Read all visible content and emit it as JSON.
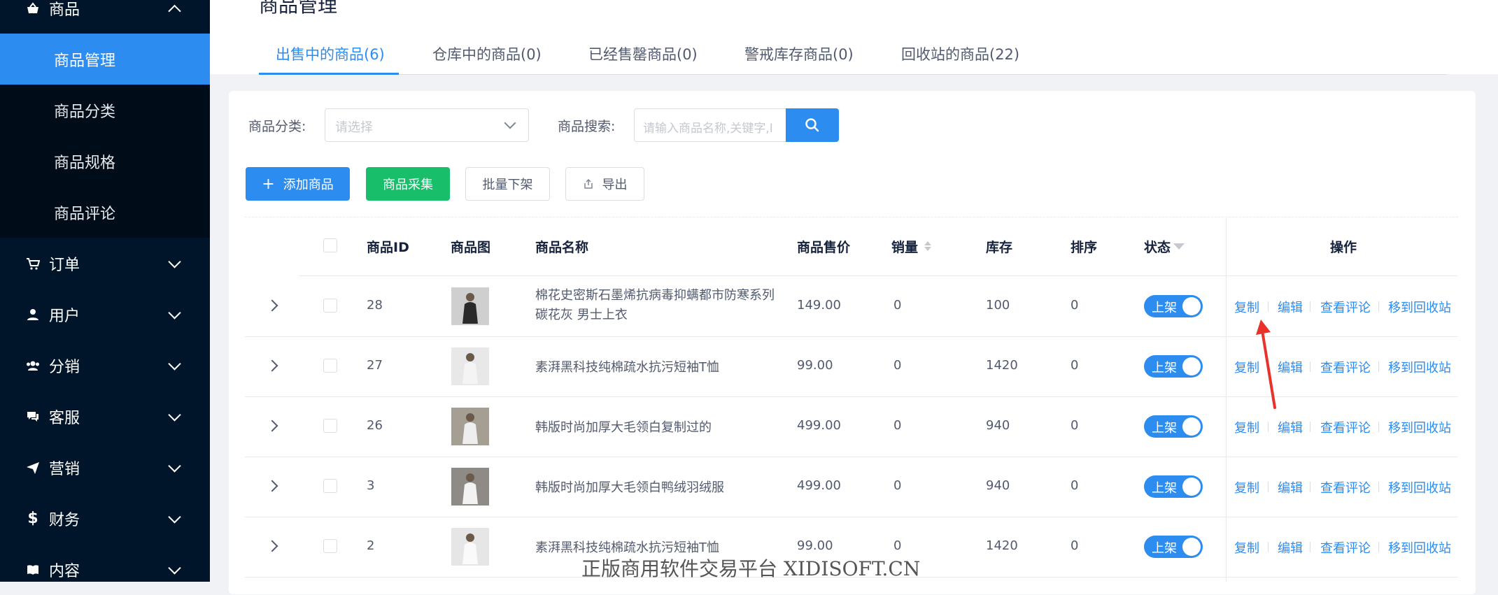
{
  "sidebar": {
    "groups": [
      {
        "label": "商品",
        "icon": "basket-icon"
      },
      {
        "label": "订单",
        "icon": "cart-icon"
      },
      {
        "label": "用户",
        "icon": "user-icon"
      },
      {
        "label": "分销",
        "icon": "group-icon"
      },
      {
        "label": "客服",
        "icon": "chat-icon"
      },
      {
        "label": "营销",
        "icon": "send-icon"
      },
      {
        "label": "财务",
        "icon": "dollar-icon"
      },
      {
        "label": "内容",
        "icon": "book-icon"
      }
    ],
    "sub_items": [
      {
        "label": "商品管理"
      },
      {
        "label": "商品分类"
      },
      {
        "label": "商品规格"
      },
      {
        "label": "商品评论"
      }
    ]
  },
  "header": {
    "title": "商品管理",
    "tabs": [
      {
        "label": "出售中的商品(6)"
      },
      {
        "label": "仓库中的商品(0)"
      },
      {
        "label": "已经售罄商品(0)"
      },
      {
        "label": "警戒库存商品(0)"
      },
      {
        "label": "回收站的商品(22)"
      }
    ]
  },
  "filters": {
    "category_label": "商品分类:",
    "category_placeholder": "请选择",
    "search_label": "商品搜索:",
    "search_placeholder": "请输入商品名称,关键字,I"
  },
  "toolbar": {
    "add_label": "添加商品",
    "collect_label": "商品采集",
    "offshelf_label": "批量下架",
    "export_label": "导出"
  },
  "table": {
    "headers": {
      "id": "商品ID",
      "image": "商品图",
      "name": "商品名称",
      "price": "商品售价",
      "sales": "销量",
      "stock": "库存",
      "sort": "排序",
      "status": "状态",
      "actions": "操作"
    },
    "rows": [
      {
        "id": "28",
        "name": "棉花史密斯石墨烯抗病毒抑螨都市防寒系列碳花灰 男士上衣",
        "price": "149.00",
        "sales": "0",
        "stock": "100",
        "sort": "0",
        "status": "上架"
      },
      {
        "id": "27",
        "name": "素湃黑科技纯棉疏水抗污短袖T恤",
        "price": "99.00",
        "sales": "0",
        "stock": "1420",
        "sort": "0",
        "status": "上架"
      },
      {
        "id": "26",
        "name": "韩版时尚加厚大毛领白复制过的",
        "price": "499.00",
        "sales": "0",
        "stock": "940",
        "sort": "0",
        "status": "上架"
      },
      {
        "id": "3",
        "name": "韩版时尚加厚大毛领白鸭绒羽绒服",
        "price": "499.00",
        "sales": "0",
        "stock": "940",
        "sort": "0",
        "status": "上架"
      },
      {
        "id": "2",
        "name": "素湃黑科技纯棉疏水抗污短袖T恤",
        "price": "99.00",
        "sales": "0",
        "stock": "1420",
        "sort": "0",
        "status": "上架"
      }
    ],
    "actions": {
      "copy": "复制",
      "edit": "编辑",
      "view_reviews": "查看评论",
      "move_recycle": "移到回收站"
    }
  },
  "watermark": "正版商用软件交易平台 XIDISOFT.CN",
  "colors": {
    "sidebar": "#001529",
    "primary": "#2d8cf0",
    "success": "#19be6b",
    "annotation_arrow": "#e8332c"
  }
}
